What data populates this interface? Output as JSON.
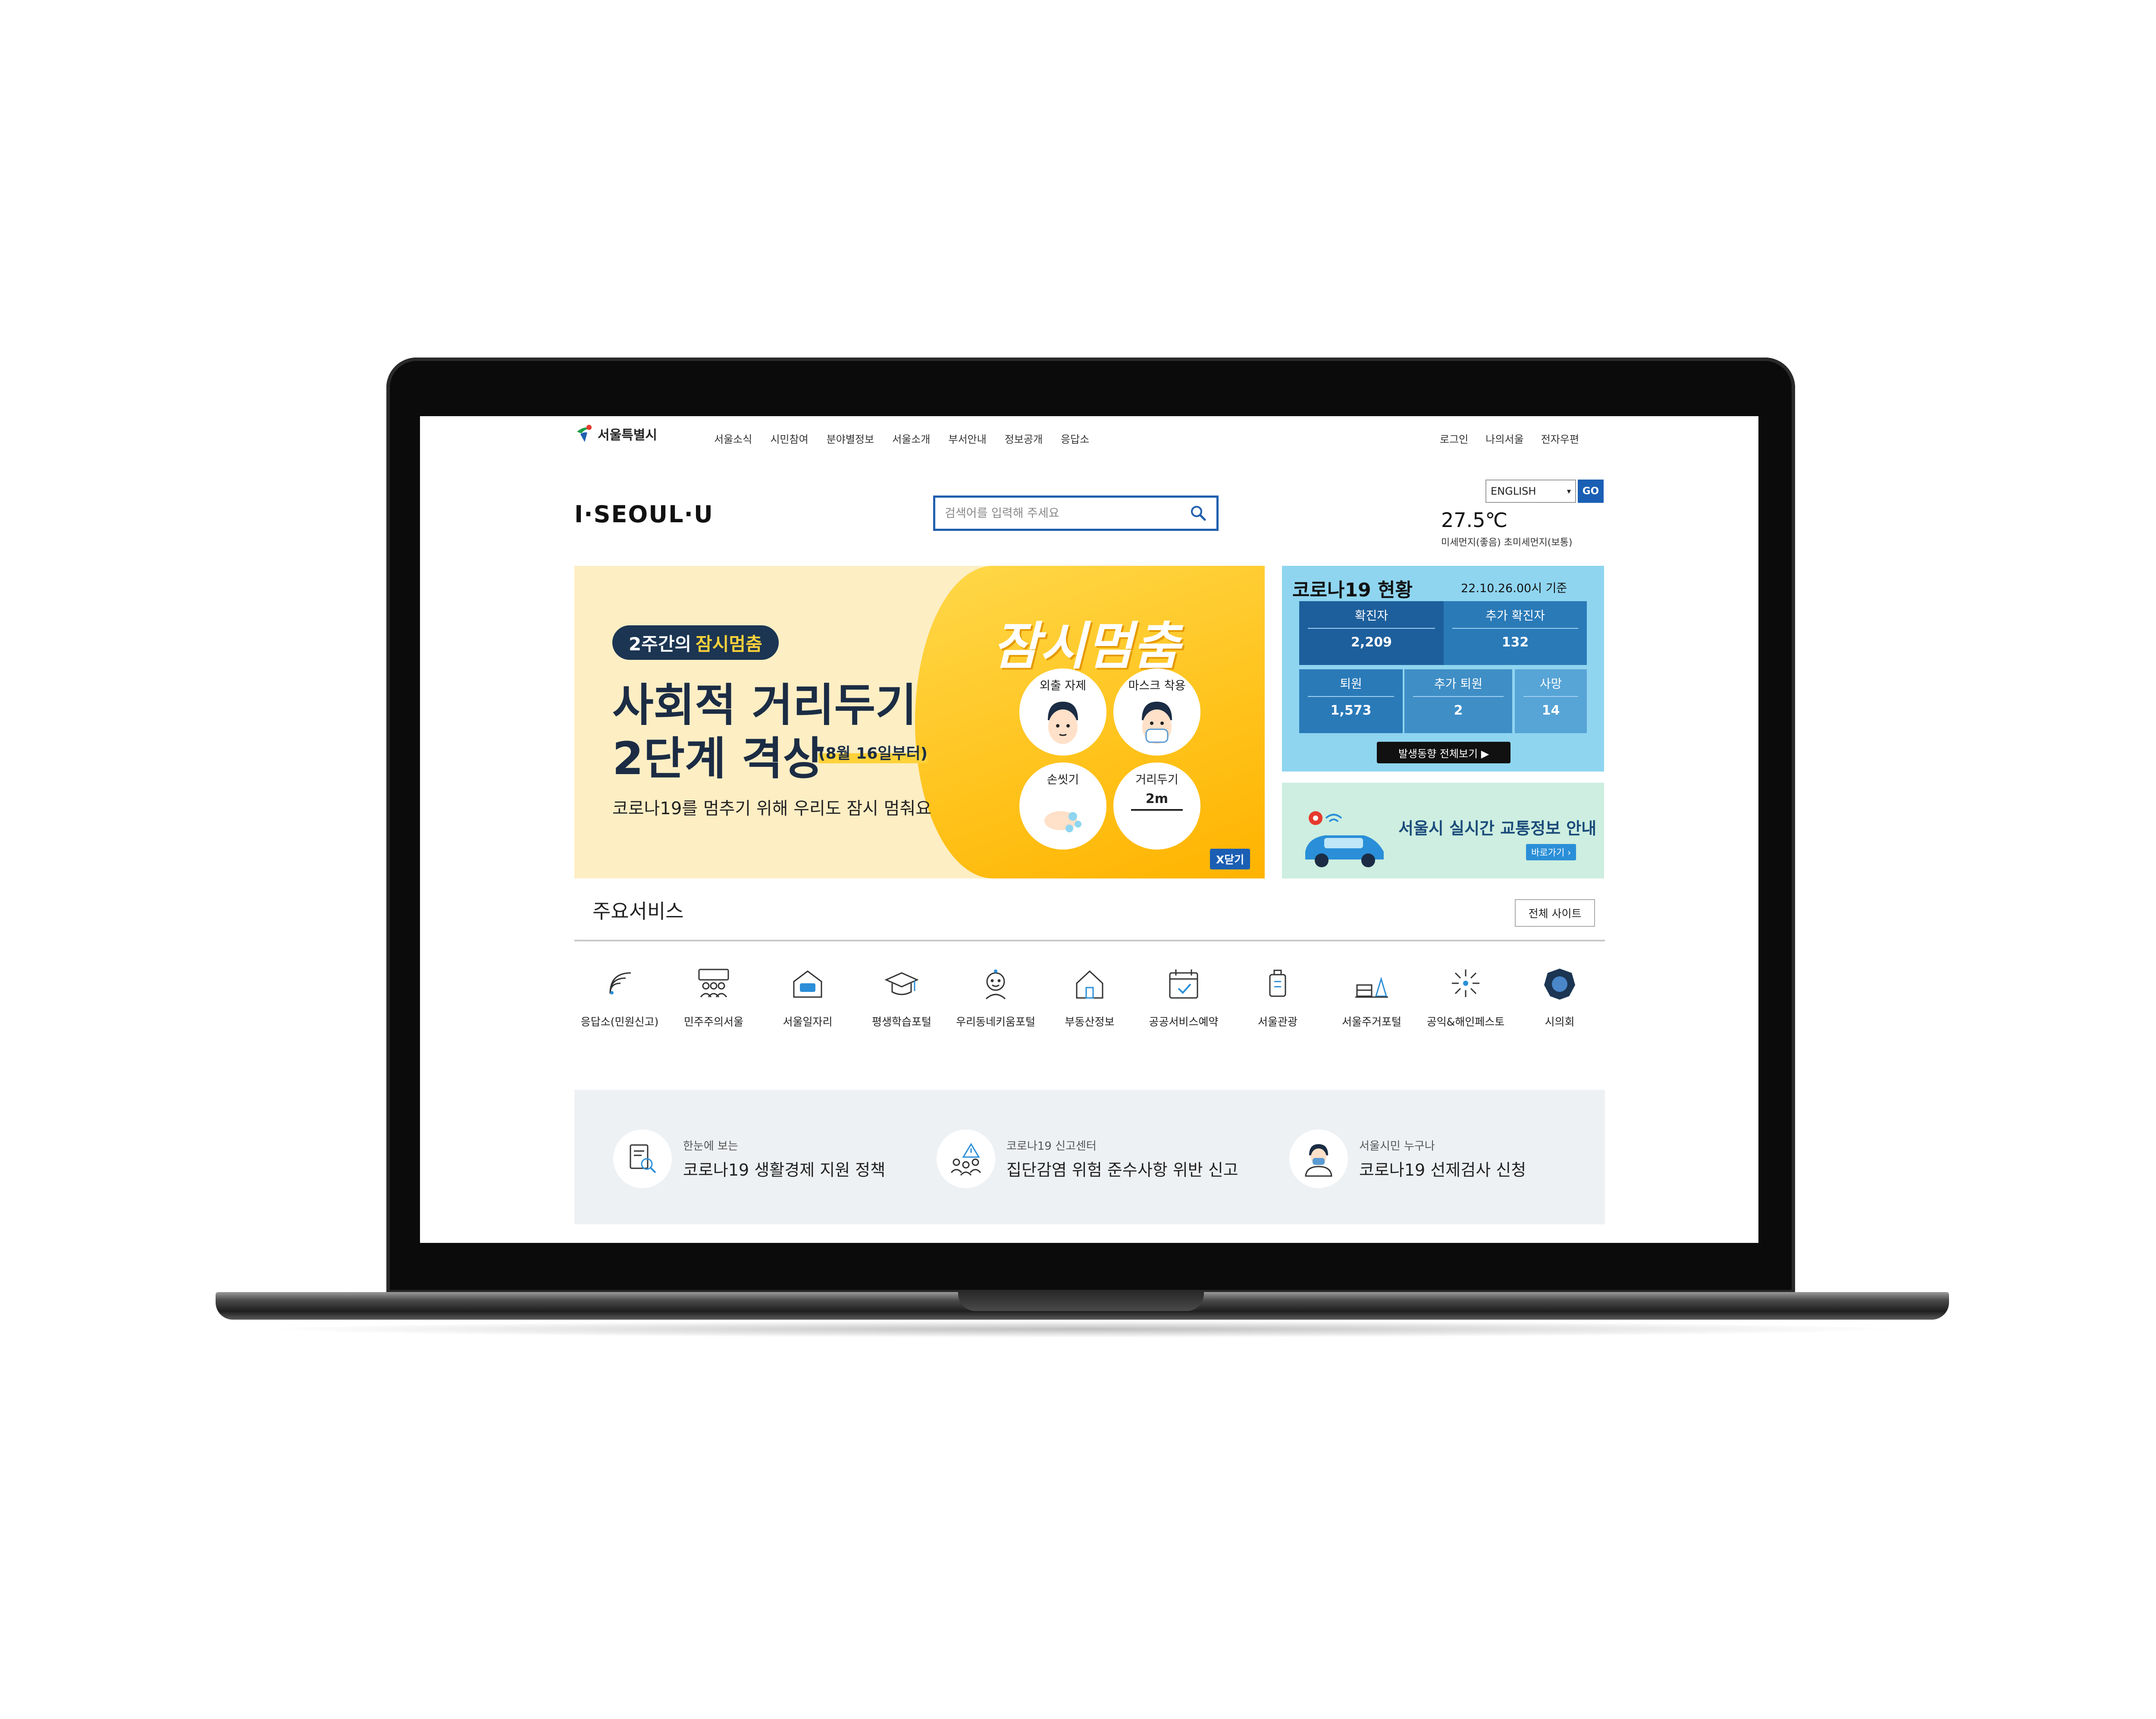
{
  "header": {
    "logo_text": "서울특별시",
    "nav": [
      "서울소식",
      "시민참여",
      "분야별정보",
      "서울소개",
      "부서안내",
      "정보공개",
      "응답소"
    ],
    "util": [
      "로그인",
      "나의서울",
      "전자우편"
    ],
    "brand": "I·SEOUL·U",
    "search_placeholder": "검색어를 입력해 주세요",
    "language": "ENGLISH",
    "go_label": "GO",
    "temperature": "27.5℃",
    "dust_info": "미세먼지(좋음) 초미세먼지(보통)"
  },
  "banner": {
    "pill_prefix": "2주간의",
    "pill_highlight": "잠시멈춤",
    "title_line1": "사회적 거리두기",
    "title_line2": "2단계 격상",
    "date_note": "(8월 16일부터)",
    "subtitle": "코로나19를 멈추기 위해 우리도 잠시 멈춰요",
    "big_text": "잠시멈춤",
    "circles": [
      "외출 자제",
      "마스크 착용",
      "손씻기",
      "거리두기"
    ],
    "distance_label": "2m",
    "close_label": "X닫기"
  },
  "covid": {
    "title": "코로나19 현황",
    "date": "22.10.26.00시 기준",
    "stats": [
      {
        "label": "확진자",
        "value": "2,209"
      },
      {
        "label": "추가 확진자",
        "value": "132"
      },
      {
        "label": "퇴원",
        "value": "1,573"
      },
      {
        "label": "추가 퇴원",
        "value": "2"
      },
      {
        "label": "사망",
        "value": "14"
      }
    ],
    "more_label": "발생동향 전체보기 ▶"
  },
  "traffic": {
    "text": "서울시 실시간 교통정보 안내",
    "button": "바로가기 ›"
  },
  "services": {
    "title": "주요서비스",
    "all_sites": "전체 사이트",
    "items": [
      {
        "label": "응답소(민원신고)",
        "icon": "wifi-icon"
      },
      {
        "label": "민주주의서울",
        "icon": "people-icon"
      },
      {
        "label": "서울일자리",
        "icon": "job-icon"
      },
      {
        "label": "평생학습포털",
        "icon": "graduation-cap-icon"
      },
      {
        "label": "우리동네키움포털",
        "icon": "child-icon"
      },
      {
        "label": "부동산정보",
        "icon": "house-icon"
      },
      {
        "label": "공공서비스예약",
        "icon": "calendar-icon"
      },
      {
        "label": "서울관광",
        "icon": "luggage-icon"
      },
      {
        "label": "서울주거포털",
        "icon": "residence-icon"
      },
      {
        "label": "공익&해인페스토",
        "icon": "firework-icon"
      },
      {
        "label": "시의회",
        "icon": "council-icon"
      }
    ]
  },
  "quick_links": [
    {
      "small": "한눈에 보는",
      "main": "코로나19 생활경제 지원 정책",
      "icon": "document-search-icon"
    },
    {
      "small": "코로나19 신고센터",
      "main": "집단감염 위험 준수사항 위반 신고",
      "icon": "warning-group-icon"
    },
    {
      "small": "서울시민 누구나",
      "main": "코로나19 선제검사 신청",
      "icon": "doctor-icon"
    }
  ],
  "colors": {
    "accent_blue": "#1a5fb4",
    "banner_yellow": "#ffc21a",
    "covid_sky": "#8fd5f0",
    "covid_dark": "#1d5f9c",
    "traffic_mint": "#cdeee0"
  }
}
